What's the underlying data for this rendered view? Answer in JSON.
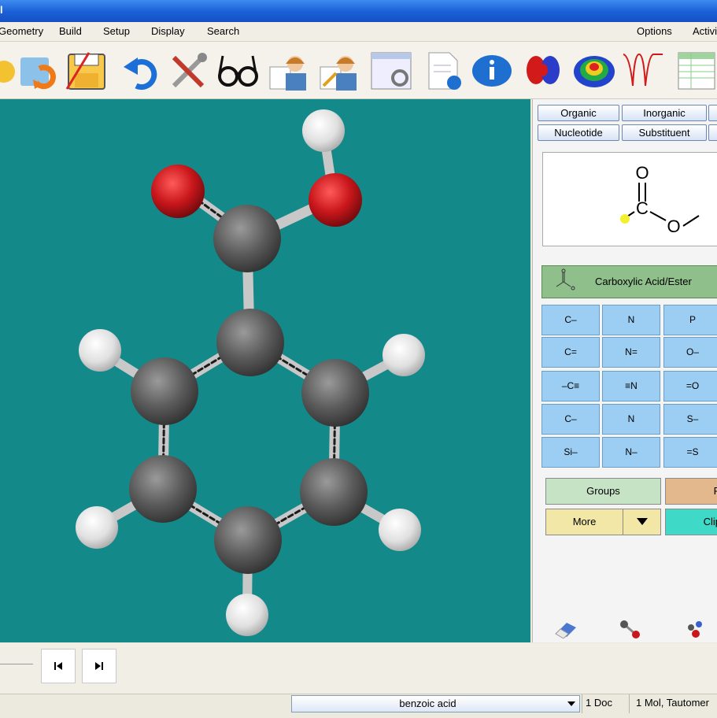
{
  "window": {
    "title": "l"
  },
  "menu": [
    "Geometry",
    "Build",
    "Setup",
    "Display",
    "Search",
    "Options",
    "Activi"
  ],
  "toolbar": {
    "icons": [
      "open-folder-icon",
      "save-disk-icon",
      "undo-icon",
      "tools-icon",
      "glasses-icon",
      "scientist-icon",
      "scientist-edit-icon",
      "settings-window-icon",
      "document-info-icon",
      "info-icon",
      "orbital-icon",
      "surface-map-icon",
      "spectrum-icon",
      "spreadsheet-icon"
    ]
  },
  "panel": {
    "tabs": [
      "Organic",
      "Inorganic",
      "Nucleotide",
      "Substituent"
    ],
    "preview": {
      "atom_o_top": "O",
      "atom_c": "C",
      "atom_o_right": "O"
    },
    "group_title": "Carboxylic Acid/Ester",
    "fragments": [
      "C–",
      "N",
      "P",
      "C=",
      "N=",
      "O–",
      "–C≡",
      "≡N",
      "=O",
      "C–",
      "N",
      "S–",
      "Si–",
      "N–",
      "=S"
    ],
    "buttons": {
      "groups": "Groups",
      "r": "R",
      "more": "More",
      "clip": "Clip"
    },
    "bottom_icons": [
      "eraser-icon",
      "bond-icon",
      "atoms-icon"
    ]
  },
  "statusbar": {
    "document": "benzoic acid",
    "doc_count": "1 Doc",
    "mol_info": "1 Mol, Tautomer"
  },
  "colors": {
    "viewport_bg": "#14898a",
    "carbon": "#5b5b5b",
    "oxygen": "#c8161b",
    "hydrogen": "#e6e6e6",
    "frag_button": "#9ccdf2"
  }
}
